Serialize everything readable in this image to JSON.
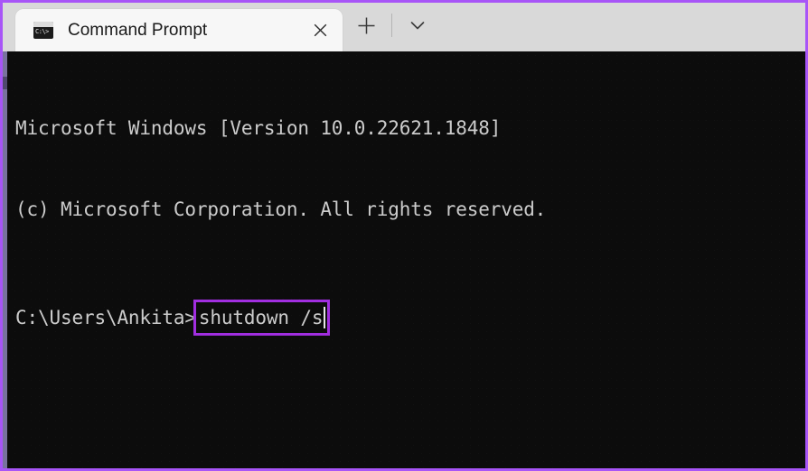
{
  "window": {
    "title": "Command Prompt",
    "frame_accent_color": "#a855f7",
    "tabbar_background": "#d9d9d9",
    "terminal_background": "#0c0c0c",
    "terminal_foreground": "#cccccc"
  },
  "tabbar": {
    "tabs": [
      {
        "label": "Command Prompt",
        "icon": "command-prompt-icon",
        "icon_glyph": "C:\\>",
        "active": true,
        "close_label": "Close"
      }
    ],
    "new_tab_label": "+",
    "dropdown_label": "v"
  },
  "terminal": {
    "lines": [
      "Microsoft Windows [Version 10.0.22621.1848]",
      "(c) Microsoft Corporation. All rights reserved."
    ],
    "prompt": {
      "path": "C:\\Users\\Ankita>",
      "command": "shutdown /s",
      "highlight_color": "#a12ee0",
      "caret_visible": true
    }
  }
}
